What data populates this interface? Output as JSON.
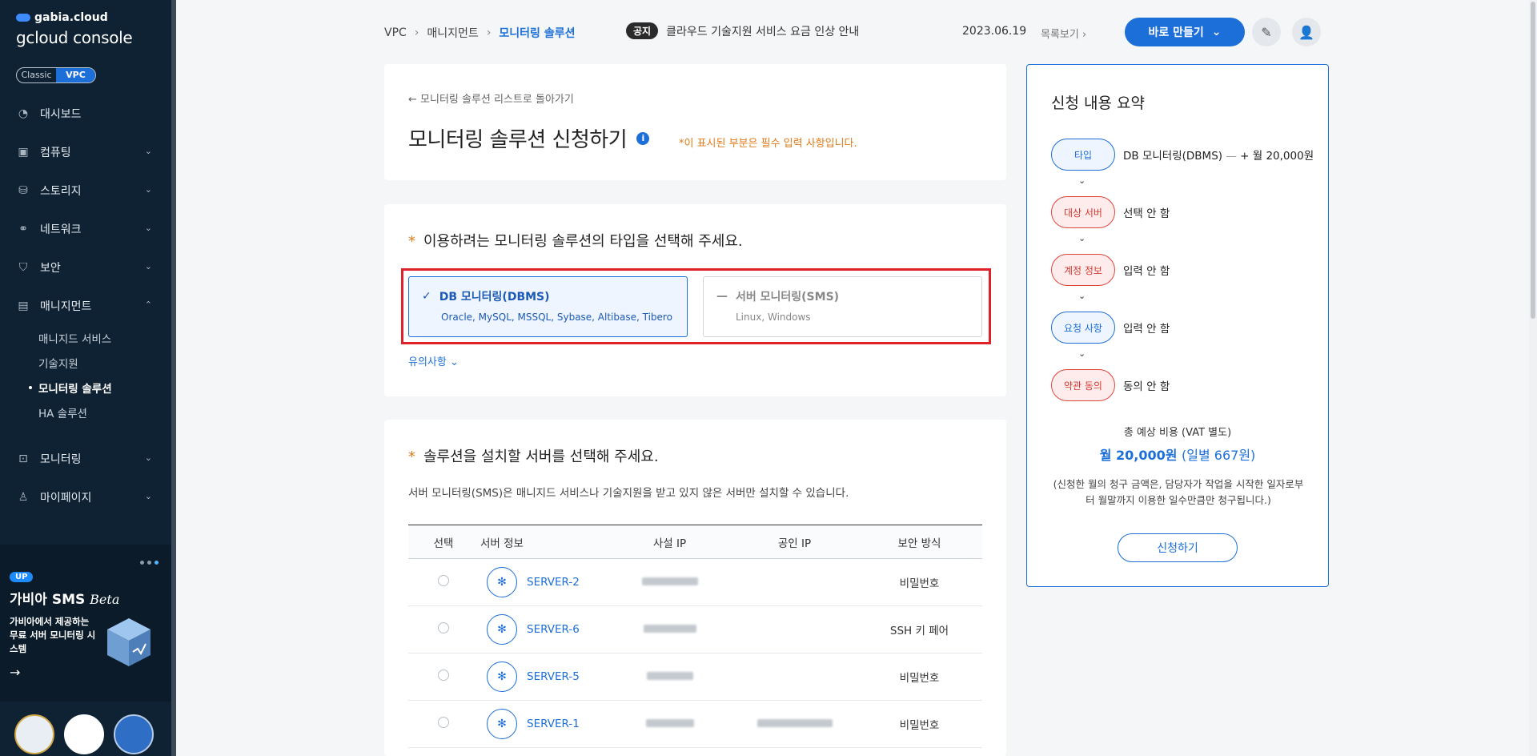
{
  "brand": {
    "small": "gabia.cloud",
    "main": "gcloud console"
  },
  "toggle": {
    "classic": "Classic",
    "vpc": "VPC"
  },
  "nav": {
    "items": [
      {
        "label": "대시보드",
        "icon": "dashboard-icon",
        "glyph": "◔",
        "chevron": ""
      },
      {
        "label": "컴퓨팅",
        "icon": "cpu-icon",
        "glyph": "▣",
        "chevron": "⌄"
      },
      {
        "label": "스토리지",
        "icon": "storage-icon",
        "glyph": "⛁",
        "chevron": "⌄"
      },
      {
        "label": "네트워크",
        "icon": "network-icon",
        "glyph": "⚭",
        "chevron": "⌄"
      },
      {
        "label": "보안",
        "icon": "shield-icon",
        "glyph": "⛉",
        "chevron": "⌄"
      },
      {
        "label": "매니지먼트",
        "icon": "management-icon",
        "glyph": "▤",
        "chevron": "⌃"
      }
    ],
    "sub_items": [
      "매니지드 서비스",
      "기술지원",
      "모니터링 솔루션",
      "HA 솔루션"
    ],
    "bottom_items": [
      {
        "label": "모니터링",
        "icon": "monitor-icon",
        "glyph": "⊡",
        "chevron": "⌄"
      },
      {
        "label": "마이페이지",
        "icon": "user-icon",
        "glyph": "♙",
        "chevron": "⌄"
      }
    ]
  },
  "ad": {
    "badge": "UP",
    "title": "가비아 SMS",
    "title_em": "Beta",
    "desc": "가비아에서 제공하는 무료 서버 모니터링 시스템",
    "arrow": "→"
  },
  "breadcrumb": {
    "root": "VPC",
    "mid": "매니지먼트",
    "current": "모니터링 솔루션",
    "sep": "›"
  },
  "notice": {
    "tag": "공지",
    "text": "클라우드 기술지원 서비스 요금 인상 안내",
    "date": "2023.06.19",
    "more": "목록보기 ›"
  },
  "header": {
    "create_label": "바로 만들기",
    "create_chevron": "⌄",
    "chat_glyph": "✎",
    "user_glyph": "👤"
  },
  "page": {
    "back": "← 모니터링 솔루션 리스트로 돌아가기",
    "title": "모니터링 솔루션 신청하기",
    "info": "i",
    "required_note": "*이 표시된 부분은 필수 입력 사항입니다."
  },
  "type_section": {
    "star": "*",
    "title": "이용하려는 모니터링 솔루션의 타입을 선택해 주세요.",
    "options": [
      {
        "mark": "✓",
        "name": "DB 모니터링(DBMS)",
        "sub": "Oracle, MySQL, MSSQL, Sybase, Altibase, Tibero"
      },
      {
        "mark": "—",
        "name": "서버 모니터링(SMS)",
        "sub": "Linux, Windows"
      }
    ],
    "caution": "유의사항 ⌄"
  },
  "server_section": {
    "star": "*",
    "title": "솔루션을 설치할 서버를 선택해 주세요.",
    "desc": "서버 모니터링(SMS)은 매니지드 서비스나 기술지원을 받고 있지 않은 서버만 설치할 수 있습니다.",
    "columns": [
      "선택",
      "서버 정보",
      "사설 IP",
      "공인 IP",
      "보안 방식"
    ],
    "rows": [
      {
        "name": "SERVER-2",
        "auth": "비밀번호"
      },
      {
        "name": "SERVER-6",
        "auth": "SSH 키 페어"
      },
      {
        "name": "SERVER-5",
        "auth": "비밀번호"
      },
      {
        "name": "SERVER-1",
        "auth": "비밀번호"
      }
    ]
  },
  "summary": {
    "title": "신청 내용 요약",
    "steps": [
      {
        "label": "타입",
        "value": "DB 모니터링(DBMS)",
        "dim": " — ",
        "extra": "+ 월 20,000원"
      },
      {
        "label": "대상 서버",
        "value": "선택 안 함",
        "dim": "",
        "extra": ""
      },
      {
        "label": "계정 정보",
        "value": "입력 안 함",
        "dim": "",
        "extra": ""
      },
      {
        "label": "요청 사항",
        "value": "입력 안 함",
        "dim": "",
        "extra": ""
      },
      {
        "label": "약관 동의",
        "value": "동의 안 함",
        "dim": "",
        "extra": ""
      }
    ],
    "step_arrow": "⌄",
    "total_label": "총 예상 비용 (VAT 별도)",
    "total_main": "월 20,000원",
    "total_daily": "(일별 667원)",
    "note": "(신청한 월의 청구 금액은, 담당자가 작업을 시작한 일자로부터 월말까지 이용한 일수만큼만 청구됩니다.)",
    "apply_label": "신청하기"
  },
  "colors": {
    "accent": "#1c6fd8",
    "warn": "#e0453c",
    "highlight": "#e0202a",
    "sidebar": "#0f2233"
  }
}
